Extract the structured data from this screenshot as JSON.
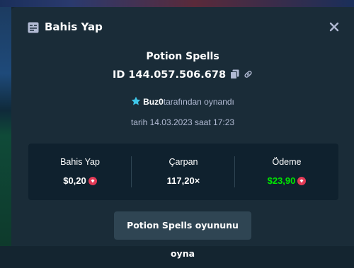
{
  "modal": {
    "title": "Bahis Yap",
    "header_icon": "bet-slip-icon",
    "close_icon": "close-icon"
  },
  "bet": {
    "game_name": "Potion Spells",
    "id_text": "ID 144.057.506.678",
    "player": "Buz0",
    "played_by_suffix": "tarafından oynandı",
    "date_text": "tarih 14.03.2023 saat 17:23"
  },
  "stats": {
    "bet_label": "Bahis Yap",
    "bet_value": "$0,20",
    "multiplier_label": "Çarpan",
    "multiplier_value": "117,20×",
    "payout_label": "Ödeme",
    "payout_value": "$23,90"
  },
  "play_button": {
    "label": "Potion Spells oyununu oyna"
  },
  "colors": {
    "payout_green": "#00e701",
    "coin_red": "#e23a56",
    "verified_blue": "#3fc6e8"
  }
}
